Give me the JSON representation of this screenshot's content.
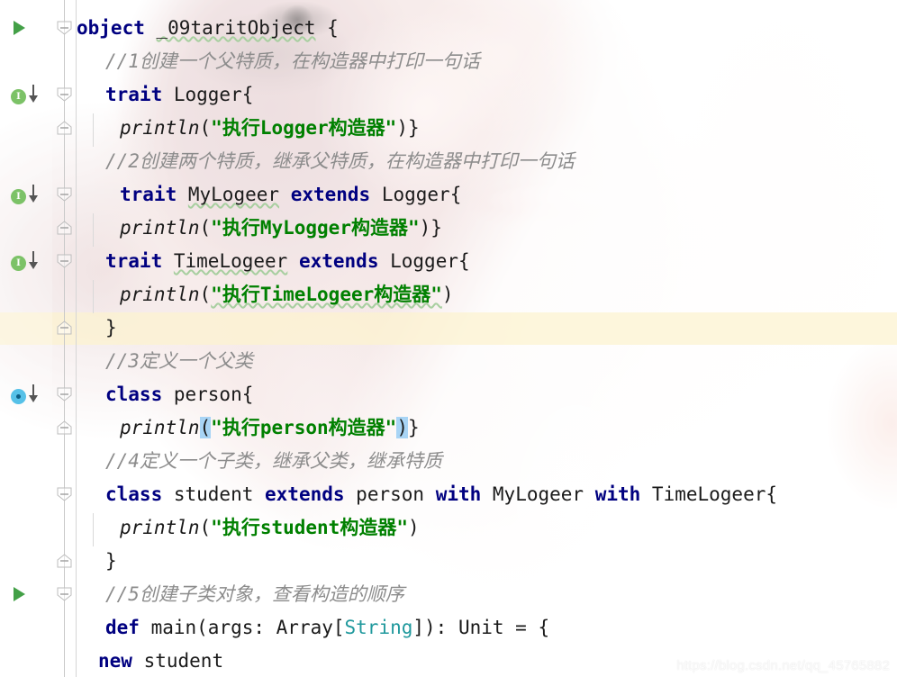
{
  "app": {
    "name": "IntelliJ IDEA Editor",
    "language": "Scala",
    "watermark": "https://blog.csdn.net/qq_45765882"
  },
  "editor": {
    "current_line_index": 9,
    "caret_after": ")",
    "colors": {
      "keyword": "#000080",
      "string": "#008000",
      "comment": "#8c8c8c",
      "type": "#20999d",
      "identifier": "#1a1a1a",
      "current_line_bg": "#fcf3cf",
      "bracket_match_bg": "#a8d4f5",
      "run_marker": "#43a047",
      "trait_marker": "#7cc267",
      "class_marker": "#56c1e8",
      "squiggle": "#a8cfa0"
    }
  },
  "gutter": {
    "markers": [
      {
        "line": 0,
        "type": "run-marker",
        "icon": "play-triangle-icon",
        "label": "Run"
      },
      {
        "line": 2,
        "type": "trait-marker",
        "icon": "implemented-badge-icon",
        "label": "I"
      },
      {
        "line": 5,
        "type": "trait-marker",
        "icon": "implemented-badge-icon",
        "label": "I"
      },
      {
        "line": 7,
        "type": "trait-marker",
        "icon": "implemented-badge-icon",
        "label": "I"
      },
      {
        "line": 11,
        "type": "class-marker",
        "icon": "overridden-badge-icon",
        "label": "o"
      },
      {
        "line": 17,
        "type": "run-marker",
        "icon": "play-triangle-icon",
        "label": "Run"
      }
    ],
    "fold_markers": [
      {
        "line": 0,
        "state": "expanded-start"
      },
      {
        "line": 2,
        "state": "expanded-start"
      },
      {
        "line": 3,
        "state": "expanded-end"
      },
      {
        "line": 5,
        "state": "expanded-start"
      },
      {
        "line": 6,
        "state": "expanded-end"
      },
      {
        "line": 7,
        "state": "expanded-start"
      },
      {
        "line": 9,
        "state": "expanded-end"
      },
      {
        "line": 11,
        "state": "expanded-start"
      },
      {
        "line": 12,
        "state": "expanded-end"
      },
      {
        "line": 14,
        "state": "expanded-start"
      },
      {
        "line": 16,
        "state": "expanded-end"
      },
      {
        "line": 17,
        "state": "expanded-start"
      }
    ]
  },
  "code": {
    "lines": [
      {
        "indent": 0,
        "tokens": [
          {
            "t": "object",
            "c": "kw"
          },
          {
            "t": " ",
            "c": "punct"
          },
          {
            "t": "_09taritObject",
            "c": "ident wavy"
          },
          {
            "t": " {",
            "c": "punct"
          }
        ]
      },
      {
        "indent": 2,
        "tokens": [
          {
            "t": "//1创建一个父特质，在构造器中打印一句话",
            "c": "cmt"
          }
        ]
      },
      {
        "indent": 2,
        "tokens": [
          {
            "t": "trait",
            "c": "kw"
          },
          {
            "t": " Logger{",
            "c": "punct"
          }
        ]
      },
      {
        "indent": 3,
        "tokens": [
          {
            "t": "println",
            "c": "meth"
          },
          {
            "t": "(",
            "c": "punct"
          },
          {
            "t": "\"执行Logger构造器\"",
            "c": "str"
          },
          {
            "t": ")}",
            "c": "punct"
          }
        ]
      },
      {
        "indent": 2,
        "tokens": [
          {
            "t": "//2创建两个特质，继承父特质，在构造器中打印一句话",
            "c": "cmt"
          }
        ]
      },
      {
        "indent": 3,
        "tokens": [
          {
            "t": "trait",
            "c": "kw"
          },
          {
            "t": " ",
            "c": "punct"
          },
          {
            "t": "MyLogeer",
            "c": "ident wavy"
          },
          {
            "t": " ",
            "c": "punct"
          },
          {
            "t": "extends",
            "c": "kw"
          },
          {
            "t": " Logger{",
            "c": "punct"
          }
        ]
      },
      {
        "indent": 3,
        "tokens": [
          {
            "t": "println",
            "c": "meth"
          },
          {
            "t": "(",
            "c": "punct"
          },
          {
            "t": "\"执行MyLogger构造器\"",
            "c": "str"
          },
          {
            "t": ")}",
            "c": "punct"
          }
        ]
      },
      {
        "indent": 2,
        "tokens": [
          {
            "t": "trait",
            "c": "kw"
          },
          {
            "t": " ",
            "c": "punct"
          },
          {
            "t": "TimeLogeer",
            "c": "ident wavy"
          },
          {
            "t": " ",
            "c": "punct"
          },
          {
            "t": "extends",
            "c": "kw"
          },
          {
            "t": " Logger{",
            "c": "punct"
          }
        ]
      },
      {
        "indent": 3,
        "tokens": [
          {
            "t": "println",
            "c": "meth"
          },
          {
            "t": "(",
            "c": "punct"
          },
          {
            "t": "\"执行TimeLogeer构造器\"",
            "c": "str wavy"
          },
          {
            "t": ")",
            "c": "punct"
          }
        ]
      },
      {
        "indent": 2,
        "tokens": [
          {
            "t": "}",
            "c": "punct"
          }
        ]
      },
      {
        "indent": 2,
        "tokens": [
          {
            "t": "//3定义一个父类",
            "c": "cmt"
          }
        ]
      },
      {
        "indent": 2,
        "tokens": [
          {
            "t": "class",
            "c": "kw"
          },
          {
            "t": " person{",
            "c": "punct"
          }
        ]
      },
      {
        "indent": 3,
        "current": true,
        "tokens": [
          {
            "t": "println",
            "c": "meth"
          },
          {
            "t": "(",
            "c": "punct brhl"
          },
          {
            "t": "\"执行person构造器\"",
            "c": "str"
          },
          {
            "t": ")",
            "c": "punct brhl"
          },
          {
            "t": "}",
            "c": "punct"
          }
        ]
      },
      {
        "indent": 2,
        "tokens": [
          {
            "t": "//4定义一个子类，继承父类，继承特质",
            "c": "cmt"
          }
        ]
      },
      {
        "indent": 2,
        "tokens": [
          {
            "t": "class",
            "c": "kw"
          },
          {
            "t": " student ",
            "c": "punct"
          },
          {
            "t": "extends",
            "c": "kw"
          },
          {
            "t": " person ",
            "c": "punct"
          },
          {
            "t": "with",
            "c": "kw"
          },
          {
            "t": " MyLogeer ",
            "c": "punct"
          },
          {
            "t": "with",
            "c": "kw"
          },
          {
            "t": " TimeLogeer{",
            "c": "punct"
          }
        ]
      },
      {
        "indent": 3,
        "tokens": [
          {
            "t": "println",
            "c": "meth"
          },
          {
            "t": "(",
            "c": "punct"
          },
          {
            "t": "\"执行student构造器\"",
            "c": "str"
          },
          {
            "t": ")",
            "c": "punct"
          }
        ]
      },
      {
        "indent": 2,
        "tokens": [
          {
            "t": "}",
            "c": "punct"
          }
        ]
      },
      {
        "indent": 2,
        "tokens": [
          {
            "t": "//5创建子类对象，查看构造的顺序",
            "c": "cmt"
          }
        ]
      },
      {
        "indent": 2,
        "tokens": [
          {
            "t": "def",
            "c": "kw"
          },
          {
            "t": " main(args: Array[",
            "c": "punct"
          },
          {
            "t": "String",
            "c": "type"
          },
          {
            "t": "]): Unit = {",
            "c": "punct"
          }
        ]
      },
      {
        "indent": 2,
        "sub": 1,
        "tokens": [
          {
            "t": "new",
            "c": "kw"
          },
          {
            "t": " student",
            "c": "punct"
          }
        ]
      }
    ]
  }
}
